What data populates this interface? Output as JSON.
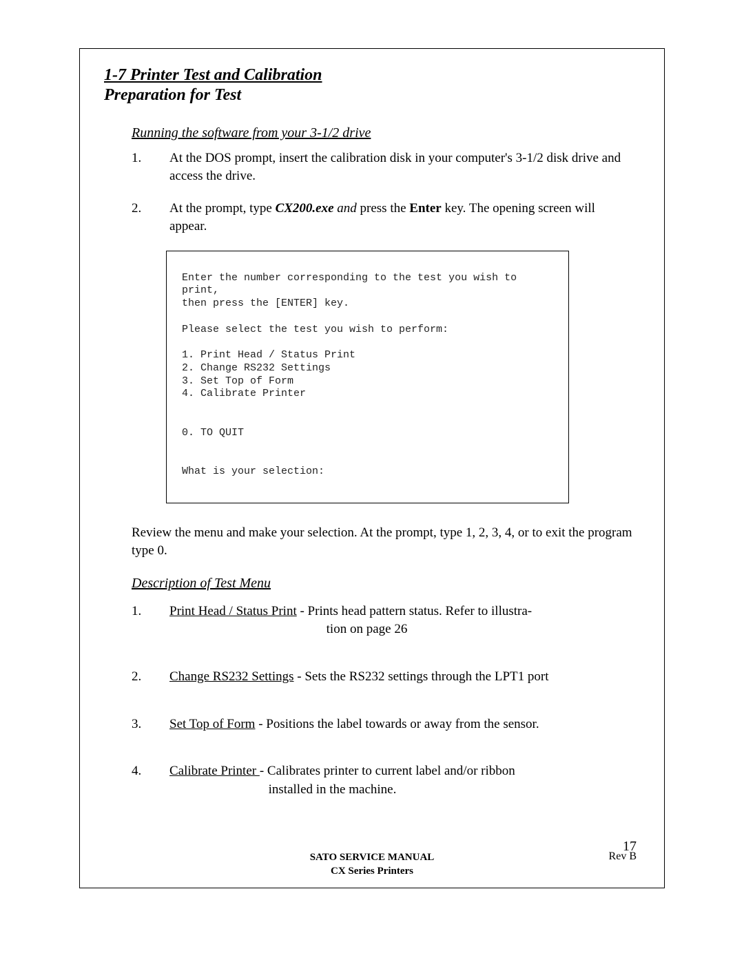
{
  "heading": "1-7  Printer Test and Calibration",
  "subheading": "Preparation for Test",
  "runSection": {
    "title": "Running  the software from your 3-1/2  drive",
    "items": [
      {
        "num": "1.",
        "text": "At the DOS prompt, insert the calibration disk in your computer's 3-1/2 disk drive and access the drive."
      },
      {
        "num": "2.",
        "prefix": "At the prompt, type ",
        "cmd": "CX200.exe",
        "mid": " and ",
        "mid2": "press the ",
        "enter": "Enter",
        "suffix": " key.   The opening screen will appear."
      }
    ]
  },
  "screenText": "Enter the number corresponding to the test you wish to print,\nthen press the [ENTER] key.\n\nPlease select the test you wish to perform:\n\n1. Print Head / Status Print\n2. Change RS232 Settings\n3. Set Top of Form\n4. Calibrate Printer\n\n\n0. TO QUIT\n\n\nWhat is your selection:",
  "reviewText": "Review the menu and make your selection. At the prompt, type 1, 2, 3, 4, or to exit the program type 0.",
  "descSection": {
    "title": "Description of Test Menu",
    "items": [
      {
        "num": "1.",
        "label": "Print Head / Status Print",
        "body": " - Prints head pattern status.  Refer to illustra-",
        "body2": "tion on  page 26"
      },
      {
        "num": "2.",
        "label": "Change RS232 Settings",
        "body": " - Sets the RS232 settings  through the LPT1 port"
      },
      {
        "num": "3.",
        "label": "Set Top of Form",
        "body": " - Positions the label towards or away from the sensor."
      },
      {
        "num": "4.",
        "label": "Calibrate Printer ",
        "body": "- Calibrates printer to current label and/or ribbon",
        "body2": "installed in the machine."
      }
    ]
  },
  "footer": {
    "line1": "SATO SERVICE MANUAL",
    "line2": "CX Series Printers",
    "rev": "Rev B",
    "page": "17"
  }
}
